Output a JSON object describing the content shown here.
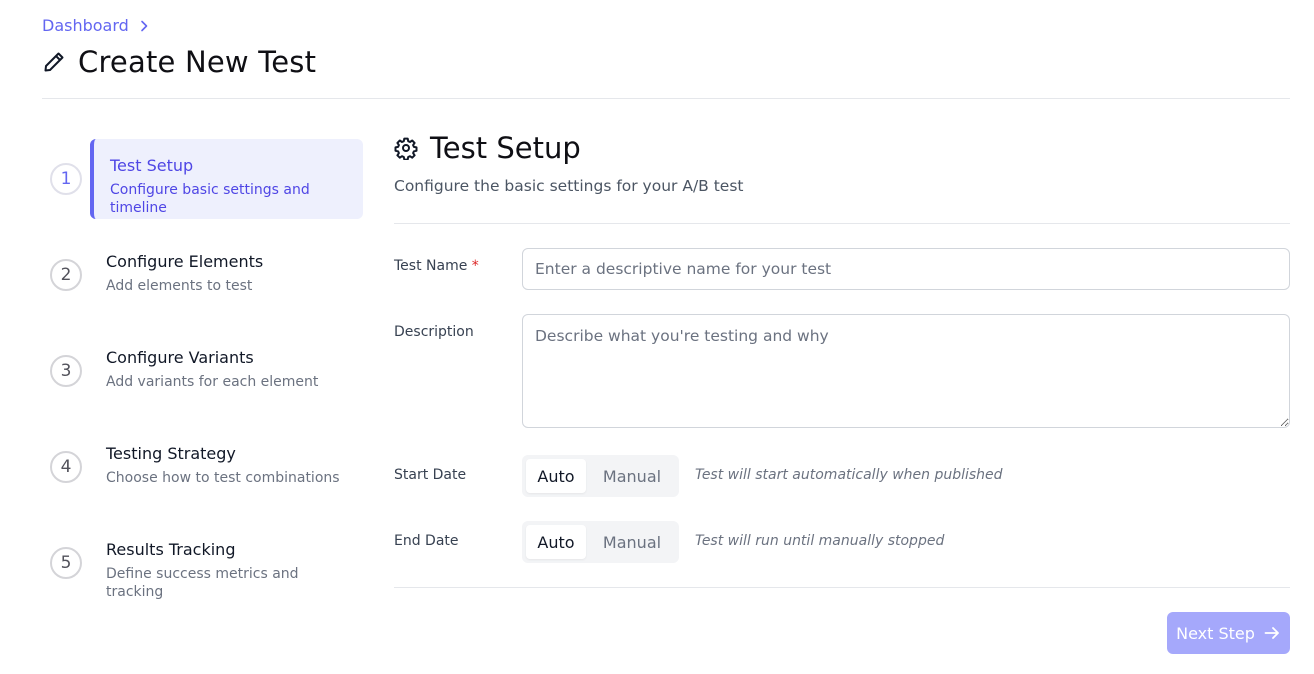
{
  "breadcrumb": {
    "link": "Dashboard"
  },
  "page": {
    "title": "Create New Test"
  },
  "steps": [
    {
      "number": "1",
      "title": "Test Setup",
      "desc": "Configure basic settings and timeline"
    },
    {
      "number": "2",
      "title": "Configure Elements",
      "desc": "Add elements to test"
    },
    {
      "number": "3",
      "title": "Configure Variants",
      "desc": "Add variants for each element"
    },
    {
      "number": "4",
      "title": "Testing Strategy",
      "desc": "Choose how to test combinations"
    },
    {
      "number": "5",
      "title": "Results Tracking",
      "desc": "Define success metrics and tracking"
    }
  ],
  "section": {
    "title": "Test Setup",
    "subtitle": "Configure the basic settings for your A/B test"
  },
  "form": {
    "name_label": "Test Name",
    "required_mark": "*",
    "name_placeholder": "Enter a descriptive name for your test",
    "description_label": "Description",
    "description_placeholder": "Describe what you're testing and why",
    "start_label": "Start Date",
    "start_auto": "Auto",
    "start_manual": "Manual",
    "start_hint": "Test will start automatically when published",
    "end_label": "End Date",
    "end_auto": "Auto",
    "end_manual": "Manual",
    "end_hint": "Test will run until manually stopped"
  },
  "footer": {
    "next_label": "Next Step"
  },
  "colors": {
    "accent": "#6366f1",
    "accent_bg": "#eef0fd",
    "button_disabled": "#a5a8fb",
    "required": "#dc2626"
  }
}
